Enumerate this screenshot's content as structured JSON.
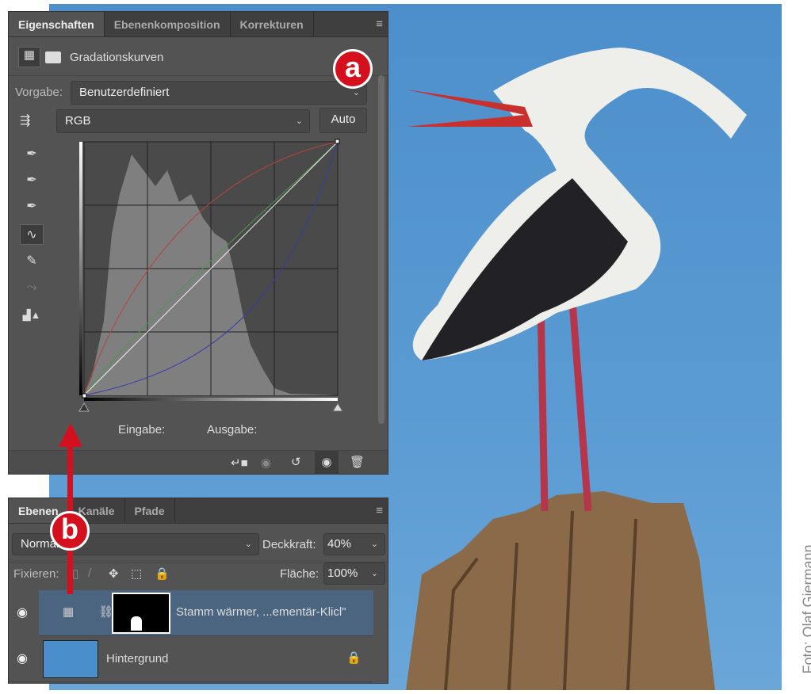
{
  "properties_panel": {
    "tabs": [
      "Eigenschaften",
      "Ebenenkomposition",
      "Korrekturen"
    ],
    "adjustment_title": "Gradationskurven",
    "preset_label": "Vorgabe:",
    "preset_value": "Benutzerdefiniert",
    "channel_value": "RGB",
    "auto_label": "Auto",
    "input_label": "Eingabe:",
    "output_label": "Ausgabe:",
    "badge": "a"
  },
  "layers_panel": {
    "tabs": [
      "Ebenen",
      "Kanäle",
      "Pfade"
    ],
    "blend_mode": "Normal",
    "opacity_label": "Deckkraft:",
    "opacity_value": "40%",
    "lock_label": "Fixieren:",
    "fill_label": "Fläche:",
    "fill_value": "100%",
    "badge": "b",
    "layers": [
      {
        "name": "Stamm wärmer, ...ementär-Klicl\"",
        "selected": true
      },
      {
        "name": "Hintergrund",
        "selected": false
      }
    ]
  },
  "credit": "Foto: Olaf Giermann",
  "colors": {
    "accent": "#d5101e",
    "panel": "#535353",
    "selected_row": "#4b6480"
  }
}
